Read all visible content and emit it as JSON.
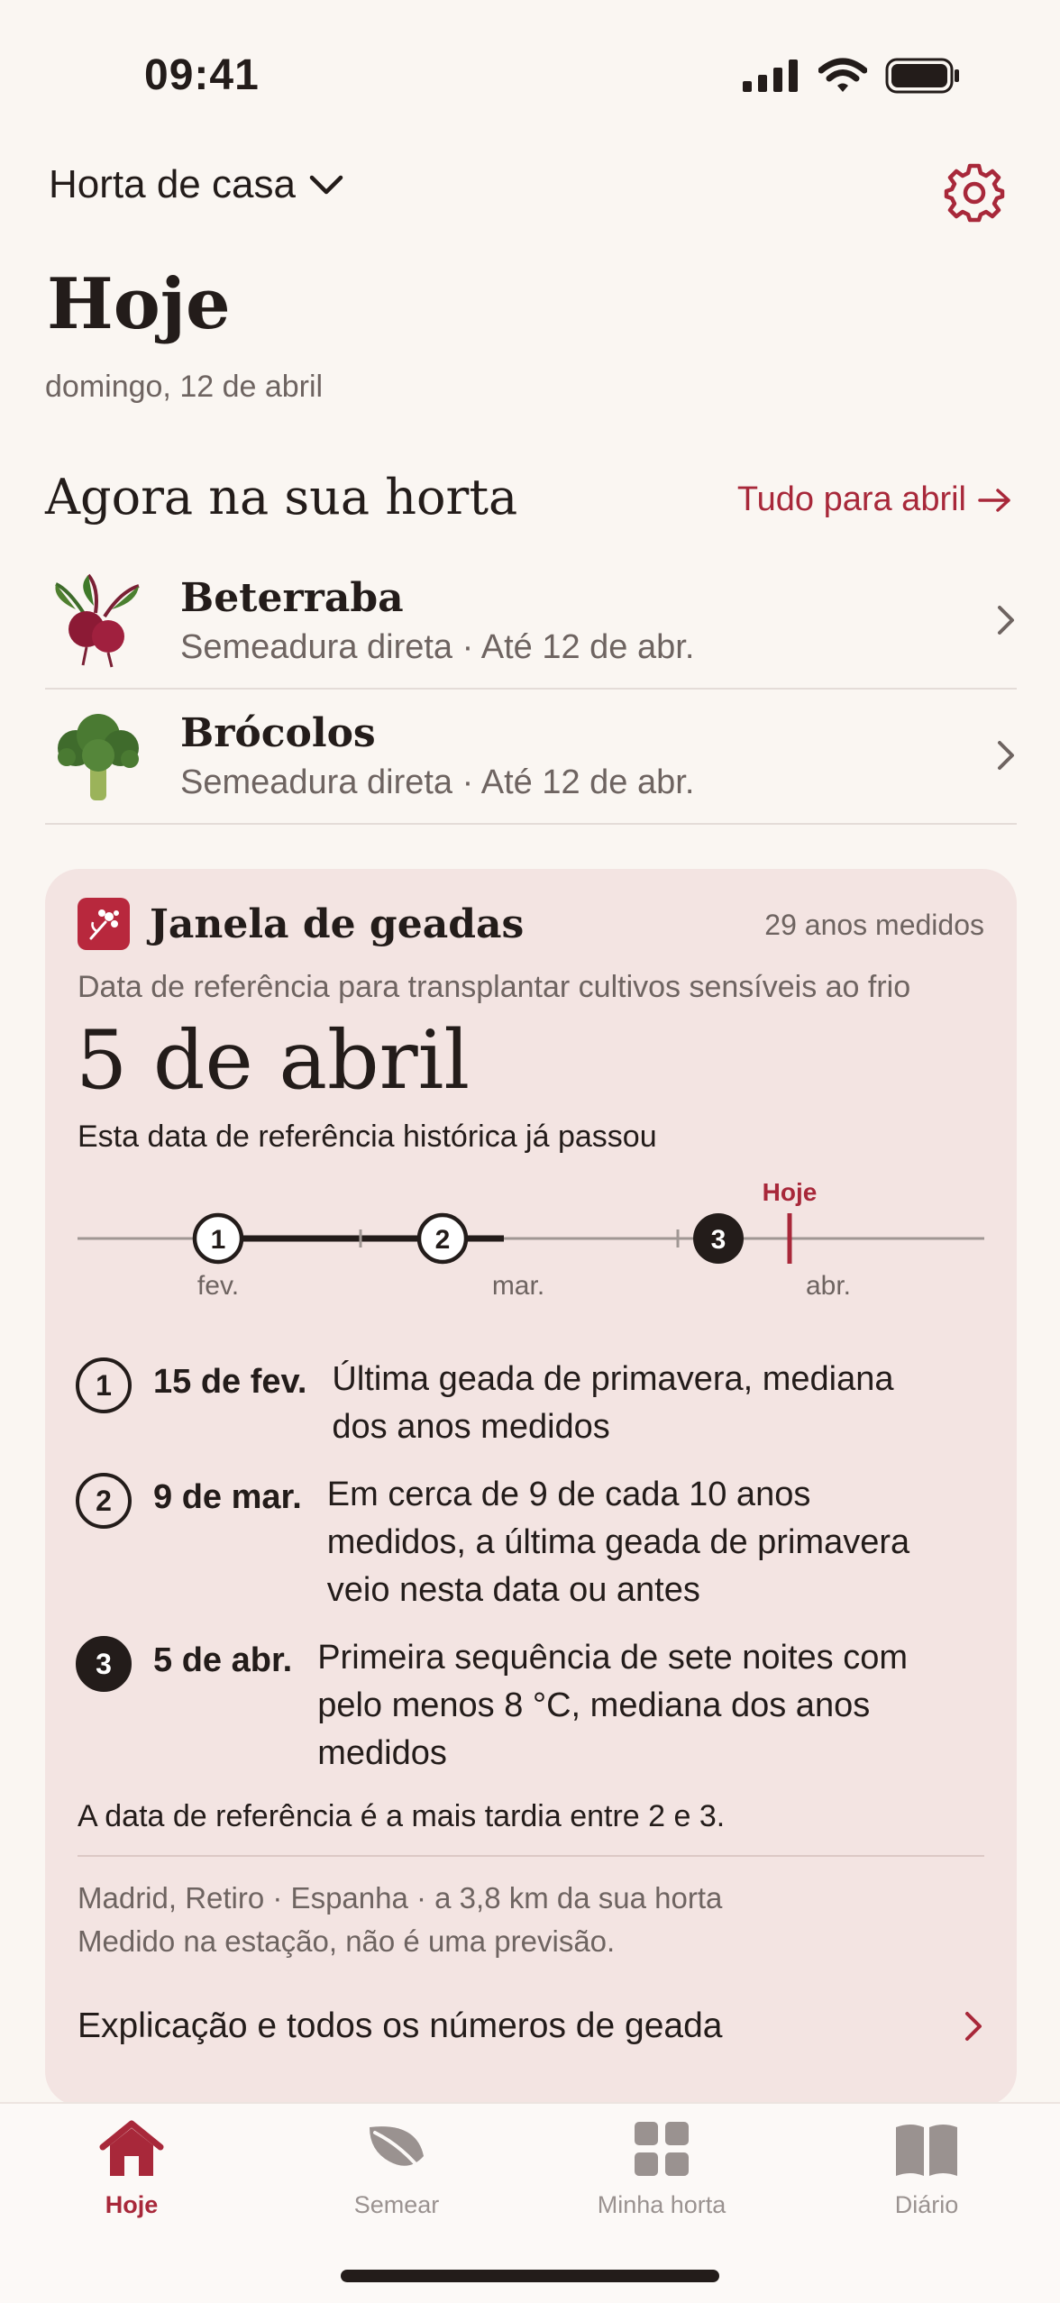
{
  "status_bar": {
    "time": "09:41"
  },
  "header": {
    "garden_name": "Horta de casa"
  },
  "page": {
    "title": "Hoje",
    "date": "domingo, 12 de abril"
  },
  "now_section": {
    "title": "Agora na sua horta",
    "link_label": "Tudo para abril",
    "crops": [
      {
        "name": "Beterraba",
        "detail": "Semeadura direta · Até 12 de abr.",
        "icon": "beetroot-icon"
      },
      {
        "name": "Brócolos",
        "detail": "Semeadura direta · Até 12 de abr.",
        "icon": "broccoli-icon"
      }
    ]
  },
  "frost_card": {
    "title": "Janela de geadas",
    "years_measured": "29 anos medidos",
    "description": "Data de referência para transplantar cultivos sensíveis ao frio",
    "reference_date": "5 de abril",
    "passed_note": "Esta data de referência histórica já passou",
    "timeline": {
      "today_label": "Hoje",
      "months": [
        "fev.",
        "mar.",
        "abr."
      ],
      "markers": [
        "1",
        "2",
        "3"
      ]
    },
    "legend": [
      {
        "num": "1",
        "date": "15 de fev.",
        "lines": [
          "Última geada de primavera, mediana",
          "dos anos medidos"
        ]
      },
      {
        "num": "2",
        "date": "9 de mar.",
        "lines": [
          "Em cerca de 9 de cada 10 anos",
          "medidos, a última geada de primavera",
          "veio nesta data ou antes"
        ]
      },
      {
        "num": "3",
        "date": "5 de abr.",
        "lines": [
          "Primeira sequência de sete noites com",
          "pelo menos 8 °C, mediana dos anos",
          "medidos"
        ]
      }
    ],
    "note": "A data de referência é a mais tardia entre 2 e 3.",
    "station": "Madrid, Retiro · Espanha · a 3,8 km da sua horta",
    "disclaimer": "Medido na estação, não é uma previsão.",
    "explain_label": "Explicação e todos os números de geada"
  },
  "tabs": [
    {
      "label": "Hoje",
      "icon": "home-icon",
      "active": true
    },
    {
      "label": "Semear",
      "icon": "leaf-icon",
      "active": false
    },
    {
      "label": "Minha horta",
      "icon": "grid-icon",
      "active": false
    },
    {
      "label": "Diário",
      "icon": "book-icon",
      "active": false
    }
  ],
  "colors": {
    "accent": "#a8283a",
    "card_bg": "#f3e4e2",
    "page_bg": "#faf6f2"
  }
}
